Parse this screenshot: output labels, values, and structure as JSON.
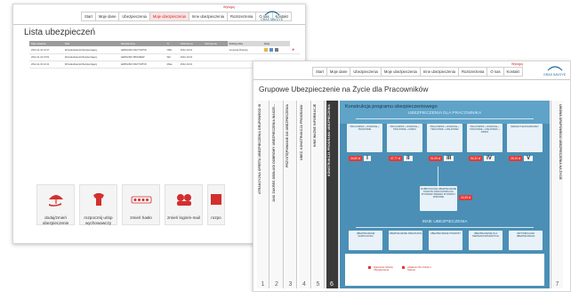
{
  "back_window": {
    "nav": [
      "Start",
      "Moje dane",
      "Ubezpieczenia",
      "Moje ubezpieczenia",
      "Inne ubezpieczenia",
      "Rozszerzenia",
      "O nas",
      "Kontakt"
    ],
    "active_nav_index": 3,
    "logout": "Wyloguj",
    "logo": "GRAS SAVOYE",
    "title": "Lista ubezpieczeń",
    "table": {
      "headers": [
        "Data zawarcia",
        "Rola",
        "Ubezpieczony",
        "Tr.",
        "Ochrona od",
        "Ochrona do",
        "Rodzaj polisy",
        "Akcje"
      ],
      "rows": [
        [
          "2012-11-19 13:37",
          "Wnioskodawca/Ubezpieczający",
          "HARNASKI KRZYSZTOF",
          "NSN",
          "2012-10-01",
          "",
          "Grupowa Pracowy",
          ""
        ],
        [
          "2012-11-19 13:51",
          "Wnioskodawca/Ubezpieczający",
          "HARNASKI ZBIGNIEW",
          "WZ",
          "2012-10-01",
          "",
          "",
          ""
        ],
        [
          "2012-11-19 14:11",
          "Wnioskodawca/Ubezpieczający",
          "HARNASKI KRZYSZTOF",
          "Mata",
          "2012-10-01",
          "",
          "",
          ""
        ]
      ]
    },
    "actions": [
      {
        "label": "dodaj/zmień ubezpieczenie",
        "icon": "umbrella-hand-icon"
      },
      {
        "label": "rozpocznij urlop wychowawczy",
        "icon": "baby-clothes-icon"
      },
      {
        "label": "zmień hasło",
        "icon": "password-stars-icon"
      },
      {
        "label": "zmień login/e-mail",
        "icon": "profile-heads-icon"
      },
      {
        "label": "rozpo",
        "icon": "partial-icon"
      }
    ]
  },
  "front_window": {
    "nav": [
      "Start",
      "Moje dane",
      "Ubezpieczenia",
      "Moje ubezpieczenia",
      "Inne ubezpieczenia",
      "Rozszerzenia",
      "O nas",
      "Kontakt"
    ],
    "logout": "Wyloguj",
    "logo": "GRAS SAVOYE",
    "title": "Grupowe Ubezpieczenie na Życie dla Pracowników",
    "strips": [
      {
        "num": "1",
        "text": "ATRAKCYJNA OFERTA UBEZPIECZENIA GRUPOWEGO III"
      },
      {
        "num": "2",
        "text": "JAKI ZAKRES OBSŁUGI DOBROWY UBEZPIECZENIA WASZE..."
      },
      {
        "num": "3",
        "text": "PRZYSTĘPOWANIE DO UBEZPIECZENIA"
      },
      {
        "num": "4",
        "text": "UBEZ. KONSTRUKCJA PROGRAMU"
      },
      {
        "num": "5",
        "text": "INNE WAŻNE INFORMACJE"
      },
      {
        "num": "6",
        "text": "KONSTRUKCJA PROGRAMU UBEZPIECZENIA"
      }
    ],
    "active_strip": 5,
    "right_strip": {
      "num": "7",
      "text": "UMOWA GRUPOWEGO UBEZPIECZENIA NA ŻYCIE"
    },
    "panel": {
      "heading": "Konstrukcja programu ubezpieczeniowego",
      "section1": "UBEZPIECZENIA DLA PRACOWNIKA",
      "variants": [
        {
          "roman": "I",
          "price": "34,60 zł",
          "box": "PRACOWNIK + RODZICE + TEŚCIOWIE"
        },
        {
          "roman": "II",
          "price": "47,77 zł",
          "box": "PRACOWNIK + RODZICE + TEŚCIOWIE + DZIECI"
        },
        {
          "roman": "III",
          "price": "51,05 zł",
          "box": "PRACOWNIK + RODZICE + TEŚCIOWIE + MAŁŻONEK"
        },
        {
          "roman": "IV",
          "price": "54,32 zł",
          "box": "PRACOWNIK + RODZICE + TEŚCIOWIE + MAŁŻONEK + DZIECI"
        },
        {
          "roman": "V",
          "price": "28,10 zł",
          "box": "WARIANT EKONOMICZNY"
        }
      ],
      "dobrowolne": {
        "box": "DOBROWOLNE UBEZPIECZENIE DODATKI PRACOWNIKA NA WYPADEK ŚMIERCI WYPADKI I ZDROWIE",
        "price": "10,25 zł"
      },
      "section2": "INNE UBEZPIECZENIA",
      "others": [
        "UBEZPIECZENIE SAMOCHODU",
        "UBEZPIECZENIE MIESZKANIA",
        "UBEZPIECZENIE PODRÓŻY",
        "UBEZPIECZENIE DLA NIEPEŁNOSPRAWNYCH",
        "INDYWIDUALNE UBEZPIECZENIA"
      ],
      "notes": [
        "Zgłoszenie Szkody Ubezpieczenia",
        "Ustalenie OFe Kolizji w Świecie"
      ]
    }
  },
  "colors": {
    "accent_red": "#e53935",
    "panel_blue": "#4b8fb6",
    "active_tab_bg": "#fbe3e3"
  }
}
